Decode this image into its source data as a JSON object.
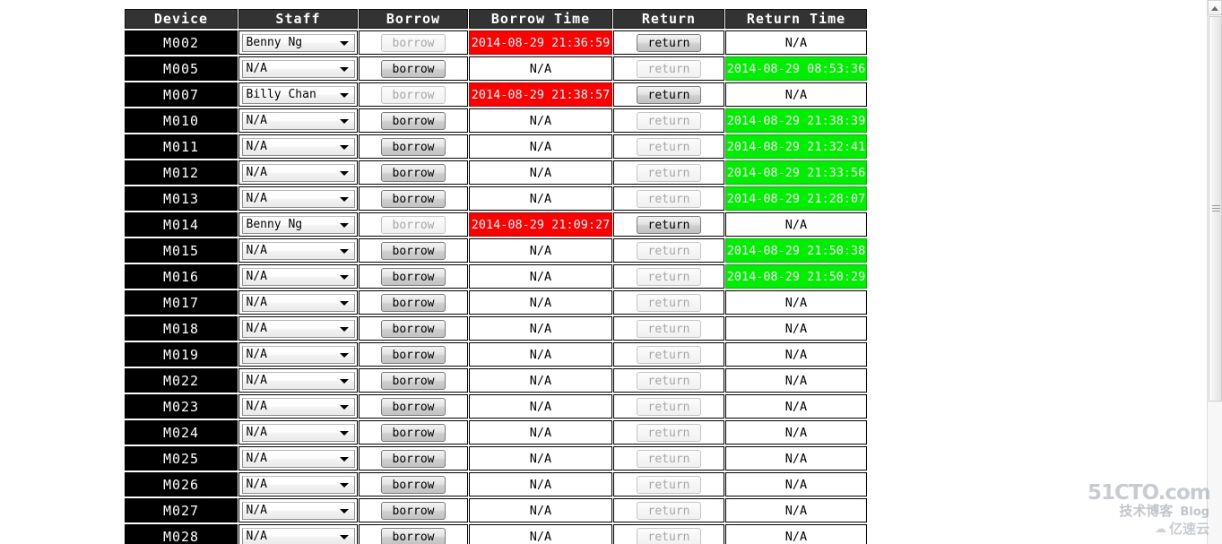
{
  "table": {
    "columns": [
      {
        "key": "device",
        "label": "Device"
      },
      {
        "key": "staff",
        "label": "Staff"
      },
      {
        "key": "borrow",
        "label": "Borrow"
      },
      {
        "key": "borrow_time",
        "label": "Borrow Time"
      },
      {
        "key": "return",
        "label": "Return"
      },
      {
        "key": "return_time",
        "label": "Return Time"
      }
    ],
    "borrow_button_label": "borrow",
    "return_button_label": "return",
    "na_text": "N/A",
    "select_arrow_icon": "chevron-down-icon",
    "rows": [
      {
        "device": "M002",
        "staff": "Benny Ng",
        "borrow_enabled": false,
        "borrow_time": "2014-08-29 21:36:59",
        "borrow_time_state": "red",
        "return_enabled": true,
        "return_time": "N/A",
        "return_time_state": "none"
      },
      {
        "device": "M005",
        "staff": "N/A",
        "borrow_enabled": true,
        "borrow_time": "N/A",
        "borrow_time_state": "none",
        "return_enabled": false,
        "return_time": "2014-08-29 08:53:36",
        "return_time_state": "green"
      },
      {
        "device": "M007",
        "staff": "Billy Chan",
        "borrow_enabled": false,
        "borrow_time": "2014-08-29 21:38:57",
        "borrow_time_state": "red",
        "return_enabled": true,
        "return_time": "N/A",
        "return_time_state": "none"
      },
      {
        "device": "M010",
        "staff": "N/A",
        "borrow_enabled": true,
        "borrow_time": "N/A",
        "borrow_time_state": "none",
        "return_enabled": false,
        "return_time": "2014-08-29 21:38:39",
        "return_time_state": "green"
      },
      {
        "device": "M011",
        "staff": "N/A",
        "borrow_enabled": true,
        "borrow_time": "N/A",
        "borrow_time_state": "none",
        "return_enabled": false,
        "return_time": "2014-08-29 21:32:41",
        "return_time_state": "green"
      },
      {
        "device": "M012",
        "staff": "N/A",
        "borrow_enabled": true,
        "borrow_time": "N/A",
        "borrow_time_state": "none",
        "return_enabled": false,
        "return_time": "2014-08-29 21:33:56",
        "return_time_state": "green"
      },
      {
        "device": "M013",
        "staff": "N/A",
        "borrow_enabled": true,
        "borrow_time": "N/A",
        "borrow_time_state": "none",
        "return_enabled": false,
        "return_time": "2014-08-29 21:28:07",
        "return_time_state": "green"
      },
      {
        "device": "M014",
        "staff": "Benny Ng",
        "borrow_enabled": false,
        "borrow_time": "2014-08-29 21:09:27",
        "borrow_time_state": "red",
        "return_enabled": true,
        "return_time": "N/A",
        "return_time_state": "none"
      },
      {
        "device": "M015",
        "staff": "N/A",
        "borrow_enabled": true,
        "borrow_time": "N/A",
        "borrow_time_state": "none",
        "return_enabled": false,
        "return_time": "2014-08-29 21:50:38",
        "return_time_state": "green"
      },
      {
        "device": "M016",
        "staff": "N/A",
        "borrow_enabled": true,
        "borrow_time": "N/A",
        "borrow_time_state": "none",
        "return_enabled": false,
        "return_time": "2014-08-29 21:50:29",
        "return_time_state": "green"
      },
      {
        "device": "M017",
        "staff": "N/A",
        "borrow_enabled": true,
        "borrow_time": "N/A",
        "borrow_time_state": "none",
        "return_enabled": false,
        "return_time": "N/A",
        "return_time_state": "none"
      },
      {
        "device": "M018",
        "staff": "N/A",
        "borrow_enabled": true,
        "borrow_time": "N/A",
        "borrow_time_state": "none",
        "return_enabled": false,
        "return_time": "N/A",
        "return_time_state": "none"
      },
      {
        "device": "M019",
        "staff": "N/A",
        "borrow_enabled": true,
        "borrow_time": "N/A",
        "borrow_time_state": "none",
        "return_enabled": false,
        "return_time": "N/A",
        "return_time_state": "none"
      },
      {
        "device": "M022",
        "staff": "N/A",
        "borrow_enabled": true,
        "borrow_time": "N/A",
        "borrow_time_state": "none",
        "return_enabled": false,
        "return_time": "N/A",
        "return_time_state": "none"
      },
      {
        "device": "M023",
        "staff": "N/A",
        "borrow_enabled": true,
        "borrow_time": "N/A",
        "borrow_time_state": "none",
        "return_enabled": false,
        "return_time": "N/A",
        "return_time_state": "none"
      },
      {
        "device": "M024",
        "staff": "N/A",
        "borrow_enabled": true,
        "borrow_time": "N/A",
        "borrow_time_state": "none",
        "return_enabled": false,
        "return_time": "N/A",
        "return_time_state": "none"
      },
      {
        "device": "M025",
        "staff": "N/A",
        "borrow_enabled": true,
        "borrow_time": "N/A",
        "borrow_time_state": "none",
        "return_enabled": false,
        "return_time": "N/A",
        "return_time_state": "none"
      },
      {
        "device": "M026",
        "staff": "N/A",
        "borrow_enabled": true,
        "borrow_time": "N/A",
        "borrow_time_state": "none",
        "return_enabled": false,
        "return_time": "N/A",
        "return_time_state": "none"
      },
      {
        "device": "M027",
        "staff": "N/A",
        "borrow_enabled": true,
        "borrow_time": "N/A",
        "borrow_time_state": "none",
        "return_enabled": false,
        "return_time": "N/A",
        "return_time_state": "none"
      },
      {
        "device": "M028",
        "staff": "N/A",
        "borrow_enabled": true,
        "borrow_time": "N/A",
        "borrow_time_state": "none",
        "return_enabled": false,
        "return_time": "N/A",
        "return_time_state": "none"
      }
    ]
  },
  "scrollbar": {
    "up_arrow_icon": "triangle-up-icon",
    "grip_icon": "grip-lines-icon"
  },
  "watermark": {
    "main": "51CTO.com",
    "sub": "技术博客",
    "blog": "Blog",
    "cloud_icon": "cloud-icon",
    "cloud": "亿速云"
  },
  "colors": {
    "header_bg": "#333333",
    "device_bg": "#000000",
    "borrowed_red": "#ff0000",
    "returned_green": "#00ee00",
    "page_bg": "#ffffff"
  }
}
